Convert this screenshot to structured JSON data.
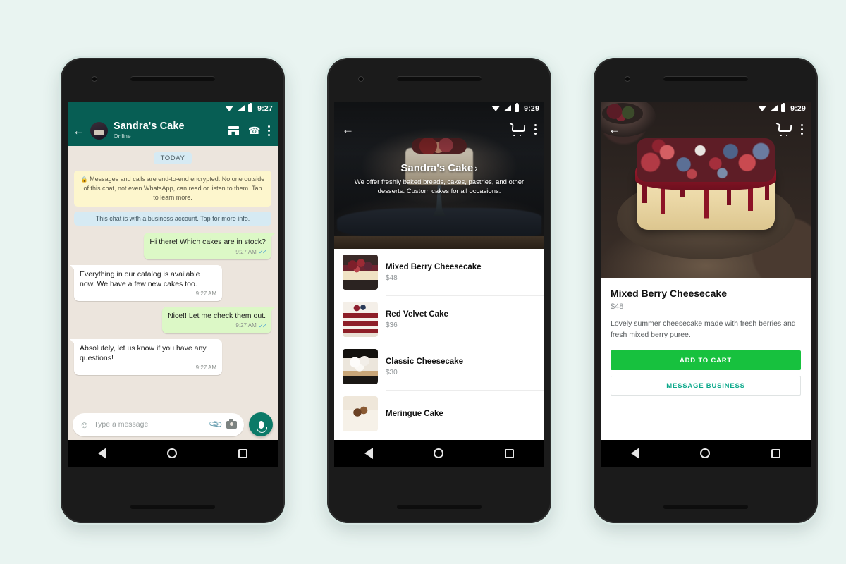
{
  "phone1": {
    "statusbar": {
      "time": "9:27",
      "icons": [
        "wifi-icon",
        "signal-icon",
        "battery-icon"
      ]
    },
    "header": {
      "back_icon": "back-arrow-icon",
      "title": "Sandra's Cake",
      "subtitle": "Online",
      "actions": [
        "storefront-icon",
        "call-add-icon",
        "overflow-menu-icon"
      ]
    },
    "chat": {
      "day_divider": "TODAY",
      "encryption_notice": "Messages and calls are end-to-end encrypted. No one outside of this chat, not even WhatsApp, can read or listen to them. Tap to learn more.",
      "business_notice": "This chat is with a business account. Tap for more info.",
      "messages": [
        {
          "side": "out",
          "text": "Hi there! Which cakes are in stock?",
          "time": "9:27 AM",
          "ticks": true
        },
        {
          "side": "in",
          "text": "Everything in our catalog is available now. We have a few new cakes too.",
          "time": "9:27 AM",
          "ticks": false
        },
        {
          "side": "out",
          "text": "Nice!! Let me check them out.",
          "time": "9:27 AM",
          "ticks": true
        },
        {
          "side": "in",
          "text": "Absolutely, let us know if you have any questions!",
          "time": "9:27 AM",
          "ticks": false
        }
      ]
    },
    "composer": {
      "placeholder": "Type a message",
      "value": "",
      "emoji_icon": "emoji-icon",
      "attach_icon": "paperclip-icon",
      "camera_icon": "camera-icon",
      "mic_icon": "microphone-icon"
    },
    "navbar": [
      "back-triangle-icon",
      "home-circle-icon",
      "recents-square-icon"
    ]
  },
  "phone2": {
    "statusbar": {
      "time": "9:29"
    },
    "nav": {
      "back_icon": "back-arrow-icon",
      "cart_icon": "shopping-cart-icon",
      "menu_icon": "overflow-menu-icon"
    },
    "hero": {
      "business_name": "Sandra's Cake",
      "chevron": "›",
      "description": "We offer freshly baked breads, cakes, pastries, and other desserts. Custom cakes for all occasions."
    },
    "products": [
      {
        "name": "Mixed Berry Cheesecake",
        "price": "$48",
        "thumb": "th-mb"
      },
      {
        "name": "Red Velvet Cake",
        "price": "$36",
        "thumb": "th-rv"
      },
      {
        "name": "Classic Cheesecake",
        "price": "$30",
        "thumb": "th-cc"
      },
      {
        "name": "Meringue Cake",
        "price": "",
        "thumb": "th-mg"
      }
    ]
  },
  "phone3": {
    "statusbar": {
      "time": "9:29"
    },
    "nav": {
      "back_icon": "back-arrow-icon",
      "cart_icon": "shopping-cart-icon",
      "menu_icon": "overflow-menu-icon"
    },
    "product": {
      "title": "Mixed Berry Cheesecake",
      "price": "$48",
      "description": "Lovely summer cheesecake made with fresh berries and fresh mixed berry puree.",
      "primary_button": "ADD TO CART",
      "secondary_button": "MESSAGE BUSINESS"
    }
  },
  "colors": {
    "page_bg": "#e9f4f1",
    "whatsapp_teal": "#075e54",
    "chat_wallpaper": "#ece5dd",
    "outgoing_bubble": "#dcf8c6",
    "add_to_cart_green": "#17c13e",
    "link_teal": "#0aa88a"
  }
}
